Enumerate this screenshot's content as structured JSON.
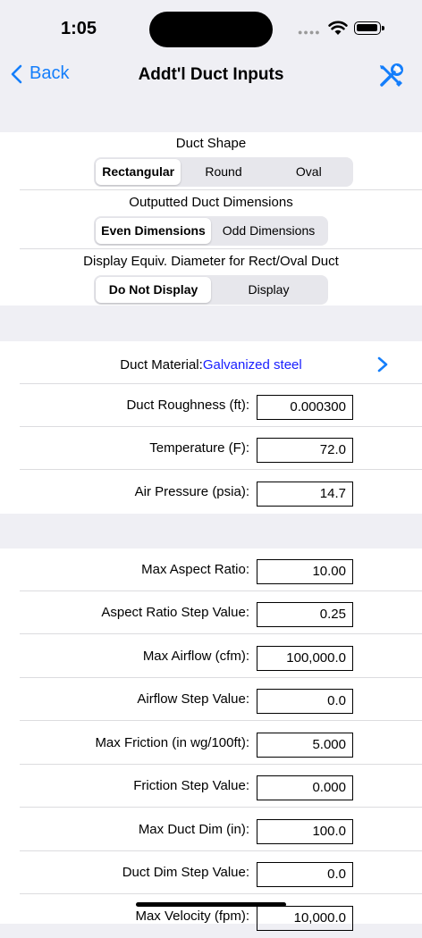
{
  "status": {
    "time": "1:05"
  },
  "nav": {
    "back_label": "Back",
    "title": "Addt'l Duct Inputs"
  },
  "duct_shape": {
    "title": "Duct Shape",
    "options": [
      "Rectangular",
      "Round",
      "Oval"
    ],
    "selected": "Rectangular"
  },
  "outputted_dims": {
    "title": "Outputted Duct Dimensions",
    "options": [
      "Even Dimensions",
      "Odd Dimensions"
    ],
    "selected": "Even Dimensions"
  },
  "equiv_diameter": {
    "title": "Display Equiv. Diameter for Rect/Oval Duct",
    "options": [
      "Do Not Display",
      "Display"
    ],
    "selected": "Do Not Display"
  },
  "material": {
    "label": "Duct Material:",
    "value": "Galvanized steel"
  },
  "properties": [
    {
      "label": "Duct Roughness (ft):",
      "value": "0.000300"
    },
    {
      "label": "Temperature (F):",
      "value": "72.0"
    },
    {
      "label": "Air Pressure (psia):",
      "value": "14.7"
    }
  ],
  "limits": [
    {
      "label": "Max Aspect Ratio:",
      "value": "10.00"
    },
    {
      "label": "Aspect Ratio Step Value:",
      "value": "0.25"
    },
    {
      "label": "Max Airflow (cfm):",
      "value": "100,000.0"
    },
    {
      "label": "Airflow Step Value:",
      "value": "0.0"
    },
    {
      "label": "Max Friction (in wg/100ft):",
      "value": "5.000"
    },
    {
      "label": "Friction Step Value:",
      "value": "0.000"
    },
    {
      "label": "Max Duct Dim (in):",
      "value": "100.0"
    },
    {
      "label": "Duct Dim Step Value:",
      "value": "0.0"
    },
    {
      "label": "Max Velocity (fpm):",
      "value": "10,000.0"
    }
  ]
}
